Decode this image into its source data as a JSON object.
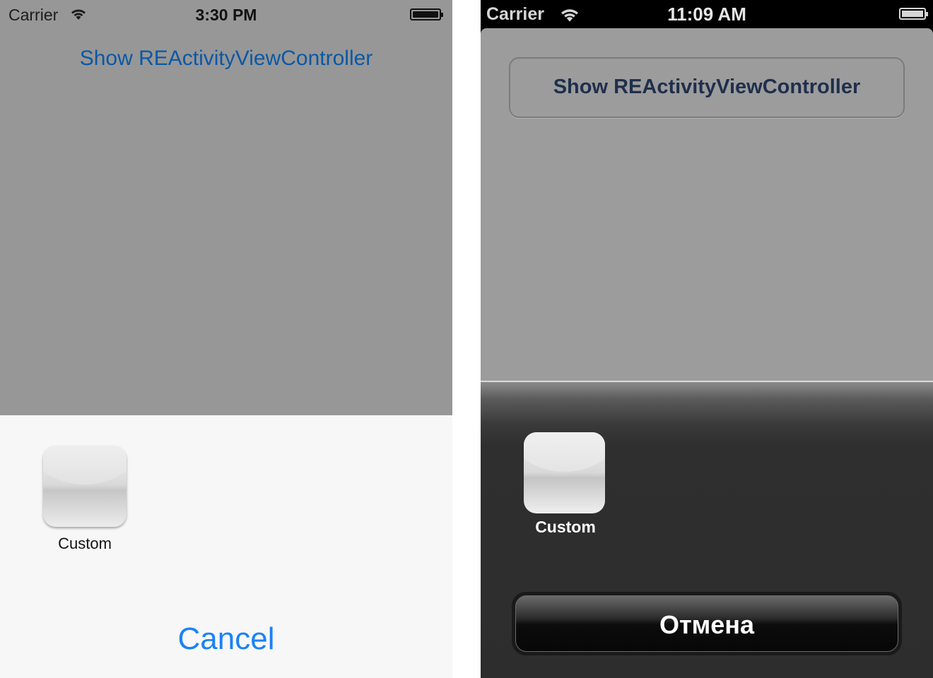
{
  "left": {
    "status_bar": {
      "carrier": "Carrier",
      "time": "3:30 PM"
    },
    "show_button_label": "Show REActivityViewController",
    "activity_sheet": {
      "activities": [
        {
          "label": "Custom",
          "icon": "custom-activity-icon"
        }
      ],
      "cancel_label": "Cancel"
    }
  },
  "right": {
    "status_bar": {
      "carrier": "Carrier",
      "time": "11:09 AM"
    },
    "show_button_label": "Show REActivityViewController",
    "activity_sheet": {
      "activities": [
        {
          "label": "Custom",
          "icon": "custom-activity-icon"
        }
      ],
      "cancel_label": "Отмена"
    }
  },
  "colors": {
    "ios7_link_blue": "#1a82f7",
    "ios7_title_blue": "#0b58a6",
    "ios6_button_text": "#1f2f4c",
    "dimmed_background": "#979797",
    "ios6_sheet": "#2d2d2d"
  }
}
